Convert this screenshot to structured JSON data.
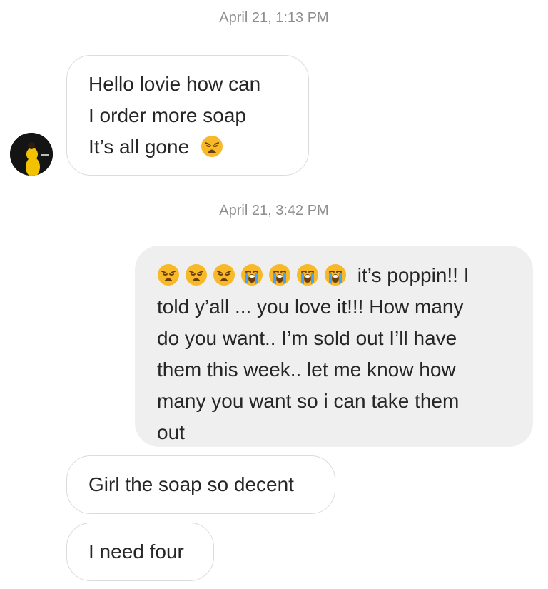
{
  "thread": {
    "timestamps": [
      "April 21, 1:13 PM",
      "April 21, 3:42 PM"
    ],
    "messages": [
      {
        "sender": "them",
        "lines": [
          "Hello lovie how can",
          "I order more soap",
          "It’s all gone"
        ],
        "trailing_emoji": "weary-face"
      },
      {
        "sender": "me",
        "leading_emojis": [
          "weary-face",
          "weary-face",
          "weary-face",
          "loudly-crying-face",
          "loudly-crying-face",
          "loudly-crying-face",
          "loudly-crying-face"
        ],
        "lines": [
          "it’s poppin!! I",
          "told y’all ... you love it!!! How many",
          "do you want.. I’m sold out I’ll have",
          "them this week.. let me know how",
          "many you want so i can take them",
          "out"
        ]
      },
      {
        "sender": "them",
        "lines": [
          "Girl the soap so decent"
        ]
      },
      {
        "sender": "them",
        "lines": [
          "I need four"
        ]
      }
    ]
  },
  "colors": {
    "incoming_bubble_border": "#dbdbdb",
    "outgoing_bubble_bg": "#efefef",
    "timestamp_text": "#8e8e8e",
    "message_text": "#262626",
    "emoji_yellow": "#f7b928",
    "emoji_tear_blue": "#4aa3f0"
  }
}
